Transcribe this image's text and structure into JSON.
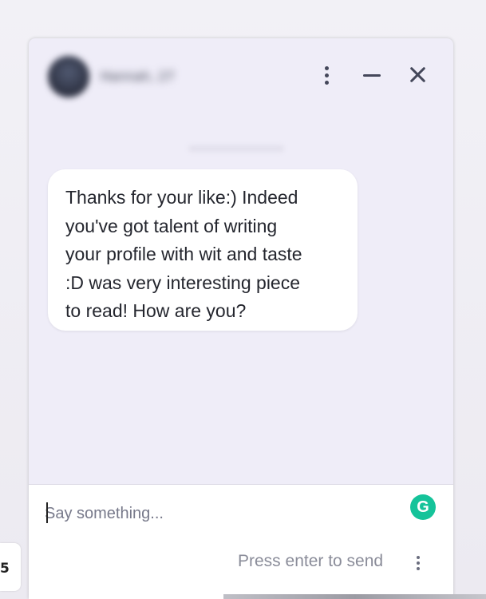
{
  "sidebar_card": {
    "number": "5"
  },
  "chat": {
    "header": {
      "contact_name": "Hannah, 27",
      "icons": [
        "more-vertical-icon",
        "minimize-icon",
        "close-icon"
      ]
    },
    "messages": [
      {
        "direction": "incoming",
        "text": "Thanks for your like:) Indeed\nyou've got talent of writing\nyour profile with wit and taste\n:D was very interesting piece\nto read! How are you?"
      }
    ],
    "composer": {
      "placeholder": "Say something...",
      "value": "",
      "hint": "Press enter to send",
      "grammarly_icon_letter": "G"
    }
  },
  "colors": {
    "chat_background": "#efedf8",
    "bubble": "#ffffff",
    "grammarly": "#15c39a",
    "icon": "#44475a",
    "hint_text": "#8a8c99"
  }
}
